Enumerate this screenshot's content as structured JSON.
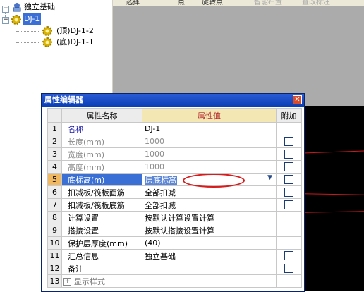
{
  "tree": {
    "root_label": "独立基础",
    "node_label": "DJ-1",
    "children": [
      "(顶)DJ-1-2",
      "(底)DJ-1-1"
    ]
  },
  "toolbar": {
    "items": [
      "选择",
      "点",
      "旋转点",
      "智能布置",
      "查改标注"
    ]
  },
  "dialog": {
    "title": "属性编辑器",
    "close_glyph": "✕",
    "headers": {
      "name": "属性名称",
      "value": "属性值",
      "extra": "附加"
    },
    "rows": [
      {
        "num": "1",
        "name": "名称",
        "value": "DJ-1",
        "checkbox": false,
        "style": "blue"
      },
      {
        "num": "2",
        "name": "长度(mm)",
        "value": "1000",
        "checkbox": true,
        "style": "gray"
      },
      {
        "num": "3",
        "name": "宽度(mm)",
        "value": "1000",
        "checkbox": true,
        "style": "gray"
      },
      {
        "num": "4",
        "name": "高度(mm)",
        "value": "1000",
        "checkbox": true,
        "style": "gray"
      },
      {
        "num": "5",
        "name": "底标高(m)",
        "value": "层底标高",
        "checkbox": true,
        "style": "selected"
      },
      {
        "num": "6",
        "name": "扣减板/筏板面筋",
        "value": "全部扣减",
        "checkbox": true,
        "style": "normal"
      },
      {
        "num": "7",
        "name": "扣减板/筏板底筋",
        "value": "全部扣减",
        "checkbox": true,
        "style": "normal"
      },
      {
        "num": "8",
        "name": "计算设置",
        "value": "按默认计算设置计算",
        "checkbox": false,
        "style": "normal"
      },
      {
        "num": "9",
        "name": "搭接设置",
        "value": "按默认搭接设置计算",
        "checkbox": false,
        "style": "normal"
      },
      {
        "num": "10",
        "name": "保护层厚度(mm)",
        "value": "(40)",
        "checkbox": false,
        "style": "normal"
      },
      {
        "num": "11",
        "name": "汇总信息",
        "value": "独立基础",
        "checkbox": true,
        "style": "normal"
      },
      {
        "num": "12",
        "name": "备注",
        "value": "",
        "checkbox": true,
        "style": "normal"
      },
      {
        "num": "13",
        "name": "显示样式",
        "value": "",
        "checkbox": false,
        "style": "group"
      }
    ],
    "dropdown_arrow": "▼",
    "expand_glyph": "+"
  },
  "colors": {
    "title_bg": "#0a3fb5",
    "header_value_bg": "#f3e8b4",
    "selected_row": "#3a6fd6",
    "annotation_ellipse": "#d81b1b"
  }
}
